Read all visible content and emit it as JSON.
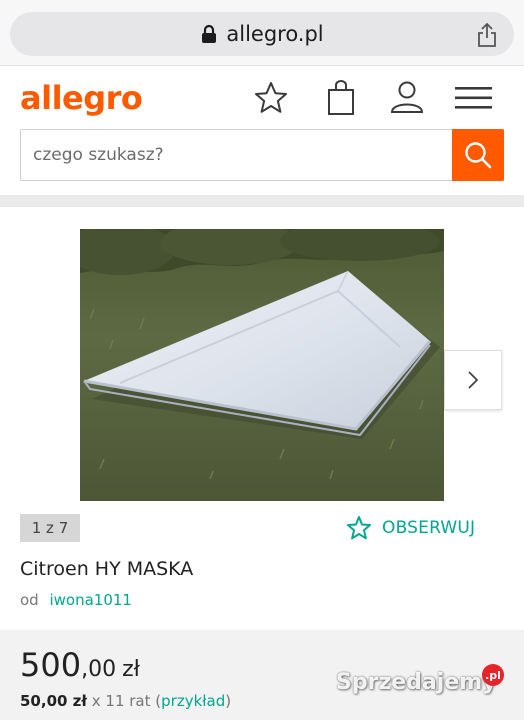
{
  "browser": {
    "url": "allegro.pl"
  },
  "header": {
    "logo": "allegro",
    "search_placeholder": "czego szukasz?"
  },
  "gallery": {
    "counter": "1 z 7"
  },
  "offer": {
    "watch_label": "OBSERWUJ",
    "title": "Citroen HY MASKA",
    "seller_prefix": "od",
    "seller_name": "iwona1011",
    "price_integer": "500",
    "price_decimal": ",00",
    "price_currency": "zł",
    "installment_amount": "50,00 zł",
    "installment_count": "x 11 rat",
    "installment_paren_open": "(",
    "installment_example": "przykład",
    "installment_paren_close": ")"
  },
  "watermark": {
    "text": "Sprzedajemy",
    "badge": ".pl"
  },
  "colors": {
    "brand": "#ff5a00",
    "accent": "#00a790"
  }
}
